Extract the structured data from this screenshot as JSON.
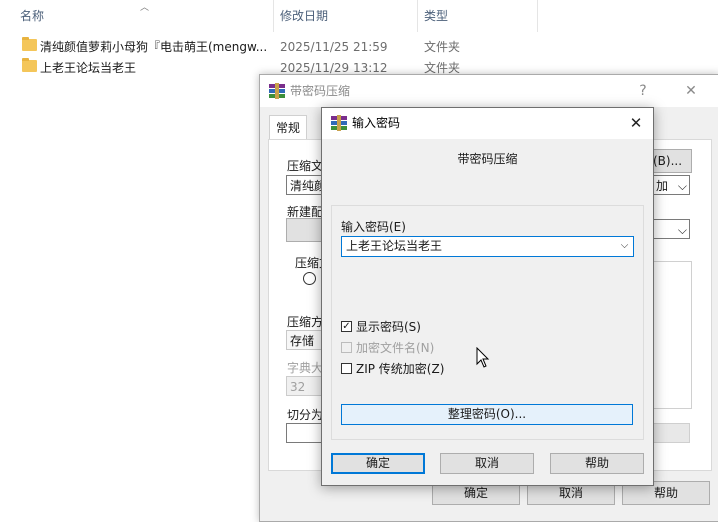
{
  "explorer": {
    "columns": {
      "name": "名称",
      "date": "修改日期",
      "type": "类型"
    },
    "files": [
      {
        "name": "清纯颜值萝莉小母狗『电击萌王(mengw...",
        "date": "2025/11/25 21:59",
        "type": "文件夹"
      },
      {
        "name": "上老王论坛当老王",
        "date": "2025/11/29 13:12",
        "type": "文件夹"
      }
    ]
  },
  "back_dialog": {
    "title": "带密码压缩",
    "help_glyph": "?",
    "close_glyph": "✕",
    "tab_general": "常规",
    "archive_name_label": "压缩文",
    "archive_name_value": "清纯颜",
    "browse_suffix": "(B)...",
    "update_mode_suffix": "加 ",
    "new_profile_label": "新建配",
    "compress_format_label": "压缩文",
    "compress_method_label": "压缩方",
    "compress_method_value": "存储",
    "dict_size_label": "字典大",
    "dict_size_value": "32",
    "split_label": "切分为",
    "ok": "确定",
    "cancel": "取消",
    "help": "帮助"
  },
  "password_dialog": {
    "title": "输入密码",
    "close_glyph": "✕",
    "subtitle": "带密码压缩",
    "enter_password_label": "输入密码(E)",
    "password_value": "上老王论坛当老王",
    "show_password": {
      "label": "显示密码(S)",
      "checked": true,
      "mark": "✓"
    },
    "encrypt_filenames": {
      "label": "加密文件名(N)",
      "checked": false,
      "disabled": true
    },
    "zip_legacy": {
      "label": "ZIP 传统加密(Z)",
      "checked": false
    },
    "organize_button": "整理密码(O)...",
    "ok": "确定",
    "cancel": "取消",
    "help": "帮助"
  }
}
